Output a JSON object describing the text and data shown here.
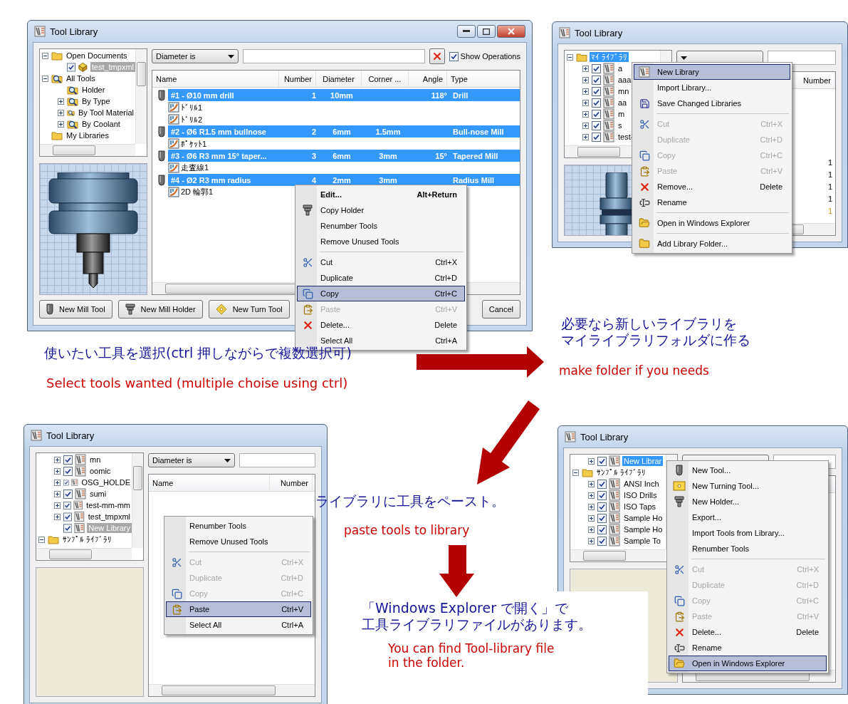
{
  "windows": [
    {
      "title": "Tool Library",
      "tree_focused": false,
      "tree": [
        {
          "label": "Open Documents",
          "kind": "folder",
          "expanded": true,
          "selected": false,
          "children": [
            {
              "label": "test_tmpxml",
              "kind": "document",
              "checked": true,
              "selected": true
            }
          ]
        },
        {
          "label": "All Tools",
          "kind": "search",
          "expanded": true,
          "selected": false,
          "children": [
            {
              "label": "Holder",
              "kind": "search",
              "selected": false
            },
            {
              "label": "By Type",
              "kind": "search",
              "expanded": false,
              "selected": false
            },
            {
              "label": "By Tool Material",
              "kind": "search",
              "expanded": false,
              "selected": false
            },
            {
              "label": "By Coolant",
              "kind": "search",
              "expanded": false,
              "selected": false
            }
          ]
        },
        {
          "label": "My Libraries",
          "kind": "folder",
          "selected": false
        }
      ],
      "filter": {
        "field": "Diameter is"
      },
      "show_operations": {
        "label": "Show Operations",
        "checked": true
      },
      "columns": [
        "Name",
        "Number",
        "Diameter",
        "Corner ...",
        "Angle",
        "Type"
      ],
      "rows": [
        {
          "kind": "tool",
          "selected": true,
          "cells": [
            "#1 - Ø10 mm drill",
            "1",
            "10mm",
            null,
            "118°",
            "Drill"
          ]
        },
        {
          "kind": "operation",
          "label": "ﾄﾞﾘﾙ1"
        },
        {
          "kind": "operation",
          "label": "ﾄﾞﾘﾙ2"
        },
        {
          "kind": "tool",
          "selected": true,
          "cells": [
            "#2 - Ø6 R1.5 mm bullnose",
            "2",
            "6mm",
            "1.5mm",
            null,
            "Bull-nose Mill"
          ]
        },
        {
          "kind": "operation",
          "label": "ﾎﾟｹｯﾄ1"
        },
        {
          "kind": "tool",
          "selected": true,
          "cells": [
            "#3 - Ø6 R3 mm 15° taper...",
            "3",
            "6mm",
            "3mm",
            "15°",
            "Tapered Mill"
          ]
        },
        {
          "kind": "operation",
          "label": "走査線1"
        },
        {
          "kind": "tool",
          "selected": true,
          "cells": [
            "#4 - Ø2 R3 mm radius",
            "4",
            "2mm",
            "3mm",
            null,
            "Radius Mill"
          ]
        },
        {
          "kind": "operation",
          "label": "2D 輪郭1"
        }
      ],
      "buttons": [
        "New Mill Tool",
        "New Mill Holder",
        "New Turn Tool",
        "Cancel"
      ],
      "menu": [
        {
          "kind": "item",
          "label": "Edit...",
          "shortcut": "Alt+Return",
          "default": true,
          "disabled": false,
          "selected": false
        },
        {
          "kind": "item",
          "label": "Copy Holder",
          "default": false,
          "disabled": false,
          "selected": false
        },
        {
          "kind": "item",
          "label": "Renumber Tools",
          "default": false,
          "disabled": false,
          "selected": false
        },
        {
          "kind": "item",
          "label": "Remove Unused Tools",
          "default": false,
          "disabled": false,
          "selected": false
        },
        {
          "kind": "separator"
        },
        {
          "kind": "item",
          "label": "Cut",
          "shortcut": "Ctrl+X",
          "default": false,
          "disabled": false,
          "selected": false
        },
        {
          "kind": "item",
          "label": "Duplicate",
          "shortcut": "Ctrl+D",
          "default": false,
          "disabled": false,
          "selected": false
        },
        {
          "kind": "item",
          "label": "Copy",
          "shortcut": "Ctrl+C",
          "default": false,
          "disabled": false,
          "selected": true
        },
        {
          "kind": "item",
          "label": "Paste",
          "shortcut": "Ctrl+V",
          "default": false,
          "disabled": true,
          "selected": false
        },
        {
          "kind": "item",
          "label": "Delete...",
          "shortcut": "Delete",
          "default": false,
          "disabled": false,
          "selected": false
        },
        {
          "kind": "item",
          "label": "Select All",
          "shortcut": "Ctrl+A",
          "default": false,
          "disabled": false,
          "selected": false
        }
      ]
    },
    {
      "title": "Tool Library",
      "tree_focused": true,
      "tree": [
        {
          "label": "ﾏｲ ﾗｲﾌﾞﾗﾘ",
          "kind": "folder",
          "expanded": true,
          "selected": true,
          "children": [
            {
              "label": "a",
              "kind": "library",
              "expanded": false,
              "checked": true,
              "selected": false
            },
            {
              "label": "aaa",
              "kind": "library",
              "expanded": false,
              "checked": true,
              "selected": false
            },
            {
              "label": "mn",
              "kind": "library",
              "expanded": false,
              "checked": true,
              "selected": false
            },
            {
              "label": "aa",
              "kind": "library",
              "expanded": false,
              "checked": true,
              "selected": false
            },
            {
              "label": "m",
              "kind": "library",
              "expanded": false,
              "checked": true,
              "selected": false
            },
            {
              "label": "s",
              "kind": "library",
              "expanded": false,
              "checked": true,
              "selected": false
            },
            {
              "label": "test-",
              "kind": "library",
              "expanded": false,
              "checked": true,
              "selected": false
            }
          ]
        }
      ],
      "columns": [
        "Number"
      ],
      "rows": [
        {
          "kind": "tool",
          "cells": [
            "1"
          ]
        },
        {
          "kind": "tool",
          "cells": [
            "1"
          ]
        },
        {
          "kind": "tool",
          "cells": [
            "1"
          ]
        },
        {
          "kind": "tool",
          "cells": [
            "1"
          ]
        },
        {
          "kind": "holder",
          "cells": [
            "1"
          ]
        }
      ],
      "menu": [
        {
          "kind": "item",
          "label": "New Library",
          "disabled": false,
          "selected": true
        },
        {
          "kind": "item",
          "label": "Import Library...",
          "disabled": false,
          "selected": false
        },
        {
          "kind": "item",
          "label": "Save Changed Libraries",
          "disabled": false,
          "selected": false
        },
        {
          "kind": "separator"
        },
        {
          "kind": "item",
          "label": "Cut",
          "shortcut": "Ctrl+X",
          "disabled": true,
          "selected": false
        },
        {
          "kind": "item",
          "label": "Duplicate",
          "shortcut": "Ctrl+D",
          "disabled": true,
          "selected": false
        },
        {
          "kind": "item",
          "label": "Copy",
          "shortcut": "Ctrl+C",
          "disabled": true,
          "selected": false
        },
        {
          "kind": "item",
          "label": "Paste",
          "shortcut": "Ctrl+V",
          "disabled": true,
          "selected": false
        },
        {
          "kind": "item",
          "label": "Remove...",
          "shortcut": "Delete",
          "disabled": false,
          "selected": false
        },
        {
          "kind": "item",
          "label": "Rename",
          "disabled": false,
          "selected": false
        },
        {
          "kind": "separator"
        },
        {
          "kind": "item",
          "label": "Open in Windows Explorer",
          "disabled": false,
          "selected": false
        },
        {
          "kind": "separator"
        },
        {
          "kind": "item",
          "label": "Add Library Folder...",
          "disabled": false,
          "selected": false
        }
      ]
    },
    {
      "title": "Tool Library",
      "tree_focused": false,
      "tree": [
        {
          "children": [
            {
              "label": "mn",
              "kind": "library",
              "expanded": false,
              "checked": true,
              "selected": false
            },
            {
              "label": "oomic",
              "kind": "library",
              "expanded": false,
              "checked": true,
              "selected": false
            },
            {
              "label": "OSG_HOLDE",
              "kind": "library",
              "expanded": false,
              "checked": true,
              "selected": false
            },
            {
              "label": "sumi",
              "kind": "library",
              "expanded": false,
              "checked": true,
              "selected": false
            },
            {
              "label": "test-mm-mm",
              "kind": "library",
              "expanded": false,
              "checked": true,
              "selected": false
            },
            {
              "label": "test_tmpxml",
              "kind": "library",
              "expanded": false,
              "checked": true,
              "selected": false
            },
            {
              "label": "New Library",
              "kind": "library",
              "checked": true,
              "selected": true
            }
          ]
        },
        {
          "label": "ｻﾝﾌﾟﾙ ﾗｲﾌﾞﾗﾘ",
          "kind": "folder",
          "expanded": true,
          "selected": false
        }
      ],
      "filter": {
        "field": "Diameter is"
      },
      "columns": [
        "Name",
        "Number"
      ],
      "menu": [
        {
          "kind": "item",
          "label": "Renumber Tools",
          "disabled": false,
          "selected": false
        },
        {
          "kind": "item",
          "label": "Remove Unused Tools",
          "disabled": false,
          "selected": false
        },
        {
          "kind": "separator"
        },
        {
          "kind": "item",
          "label": "Cut",
          "shortcut": "Ctrl+X",
          "disabled": true,
          "selected": false
        },
        {
          "kind": "item",
          "label": "Duplicate",
          "shortcut": "Ctrl+D",
          "disabled": true,
          "selected": false
        },
        {
          "kind": "item",
          "label": "Copy",
          "shortcut": "Ctrl+C",
          "disabled": true,
          "selected": false
        },
        {
          "kind": "item",
          "label": "Paste",
          "shortcut": "Ctrl+V",
          "disabled": false,
          "selected": true
        },
        {
          "kind": "item",
          "label": "Select All",
          "shortcut": "Ctrl+A",
          "disabled": false,
          "selected": false
        }
      ]
    },
    {
      "title": "Tool Library",
      "tree_focused": true,
      "tree": [
        {
          "children": [
            {
              "label": "New Librar",
              "kind": "library",
              "expanded": false,
              "checked": true,
              "selected": true
            }
          ]
        },
        {
          "label": "ｻﾝﾌﾟﾙ ﾗｲﾌﾞﾗﾘ",
          "kind": "folder",
          "expanded": true,
          "selected": false,
          "children": [
            {
              "label": "ANSI Inch",
              "kind": "library",
              "expanded": false,
              "checked": true,
              "selected": false
            },
            {
              "label": "ISO Drills",
              "kind": "library",
              "expanded": false,
              "checked": true,
              "selected": false
            },
            {
              "label": "ISO Taps",
              "kind": "library",
              "expanded": false,
              "checked": true,
              "selected": false
            },
            {
              "label": "Sample Ho",
              "kind": "library",
              "expanded": false,
              "checked": true,
              "selected": false
            },
            {
              "label": "Sample Ho",
              "kind": "library",
              "expanded": false,
              "checked": true,
              "selected": false
            },
            {
              "label": "Sample To",
              "kind": "library",
              "expanded": false,
              "checked": true,
              "selected": false
            }
          ]
        }
      ],
      "menu": [
        {
          "kind": "item",
          "label": "New Tool...",
          "disabled": false,
          "selected": false
        },
        {
          "kind": "item",
          "label": "New Turning Tool...",
          "disabled": false,
          "selected": false
        },
        {
          "kind": "item",
          "label": "New Holder...",
          "disabled": false,
          "selected": false
        },
        {
          "kind": "item",
          "label": "Export...",
          "disabled": false,
          "selected": false
        },
        {
          "kind": "item",
          "label": "Import Tools from Library...",
          "disabled": false,
          "selected": false
        },
        {
          "kind": "item",
          "label": "Renumber Tools",
          "disabled": false,
          "selected": false
        },
        {
          "kind": "separator"
        },
        {
          "kind": "item",
          "label": "Cut",
          "shortcut": "Ctrl+X",
          "disabled": true,
          "selected": false
        },
        {
          "kind": "item",
          "label": "Duplicate",
          "shortcut": "Ctrl+D",
          "disabled": true,
          "selected": false
        },
        {
          "kind": "item",
          "label": "Copy",
          "shortcut": "Ctrl+C",
          "disabled": true,
          "selected": false
        },
        {
          "kind": "item",
          "label": "Paste",
          "shortcut": "Ctrl+V",
          "disabled": true,
          "selected": false
        },
        {
          "kind": "item",
          "label": "Delete...",
          "shortcut": "Delete",
          "disabled": false,
          "selected": false
        },
        {
          "kind": "item",
          "label": "Rename",
          "disabled": false,
          "selected": false
        },
        {
          "kind": "item",
          "label": "Open in Windows Explorer",
          "disabled": false,
          "selected": true
        }
      ]
    }
  ],
  "annotations": [
    {
      "kind": "japanese",
      "lines": [
        "使いたい工具を選択(ctrl 押しながらで複数選択可)"
      ]
    },
    {
      "kind": "english",
      "lines": [
        "Select tools wanted (multiple choise using ctrl)"
      ]
    },
    {
      "kind": "japanese",
      "lines": [
        "必要なら新しいライブラリを",
        "マイライブラリフォルダに作る"
      ]
    },
    {
      "kind": "english",
      "lines": [
        "make folder if you needs"
      ]
    },
    {
      "kind": "japanese",
      "lines": [
        "ライブラリに工具をペースト。"
      ]
    },
    {
      "kind": "english",
      "lines": [
        "paste tools to library"
      ]
    },
    {
      "kind": "japanese",
      "lines": [
        "「Windows Explorer で開く」で",
        "工具ライブラリファイルがあります。"
      ]
    },
    {
      "kind": "english",
      "lines": [
        "You can find Tool-library file",
        "in the folder."
      ]
    }
  ]
}
